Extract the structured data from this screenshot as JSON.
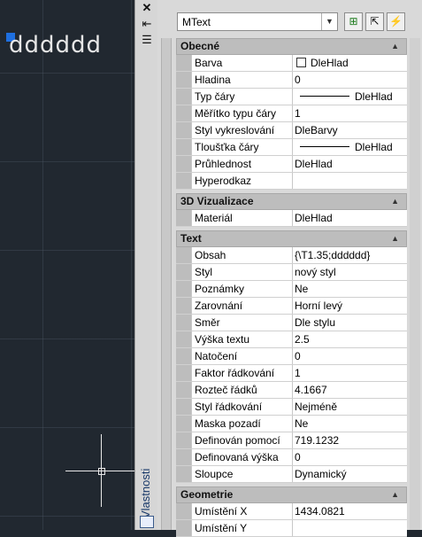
{
  "canvas": {
    "mtext_content": "dddddd"
  },
  "strip": {
    "title": "Vlastnosti",
    "close_glyph": "✕",
    "autohide_glyph": "⇤",
    "menu_glyph": "☰"
  },
  "panel": {
    "object_type": "MText",
    "sections": [
      {
        "title": "Obecné",
        "rows": [
          {
            "name": "Barva",
            "value": "DleHlad",
            "swatch": true
          },
          {
            "name": "Hladina",
            "value": "0"
          },
          {
            "name": "Typ čáry",
            "value": "DleHlad",
            "line": true
          },
          {
            "name": "Měřítko typu čáry",
            "value": "1"
          },
          {
            "name": "Styl vykreslování",
            "value": "DleBarvy"
          },
          {
            "name": "Tloušťka čáry",
            "value": "DleHlad",
            "line": true
          },
          {
            "name": "Průhlednost",
            "value": "DleHlad"
          },
          {
            "name": "Hyperodkaz",
            "value": ""
          }
        ]
      },
      {
        "title": "3D Vizualizace",
        "rows": [
          {
            "name": "Materiál",
            "value": "DleHlad"
          }
        ]
      },
      {
        "title": "Text",
        "rows": [
          {
            "name": "Obsah",
            "value": "{\\T1.35;dddddd}"
          },
          {
            "name": "Styl",
            "value": "nový styl"
          },
          {
            "name": "Poznámky",
            "value": "Ne"
          },
          {
            "name": "Zarovnání",
            "value": "Horní levý"
          },
          {
            "name": "Směr",
            "value": "Dle stylu"
          },
          {
            "name": "Výška textu",
            "value": "2.5"
          },
          {
            "name": "Natočení",
            "value": "0"
          },
          {
            "name": "Faktor řádkování",
            "value": "1"
          },
          {
            "name": "Rozteč řádků",
            "value": "4.1667"
          },
          {
            "name": "Styl řádkování",
            "value": "Nejméně"
          },
          {
            "name": "Maska pozadí",
            "value": "Ne"
          },
          {
            "name": "Definován pomocí",
            "value": "719.1232"
          },
          {
            "name": "Definovaná výška",
            "value": "0"
          },
          {
            "name": "Sloupce",
            "value": "Dynamický"
          }
        ]
      },
      {
        "title": "Geometrie",
        "rows": [
          {
            "name": "Umístění X",
            "value": "1434.0821"
          },
          {
            "name": "Umístění Y",
            "value": ""
          }
        ]
      }
    ]
  }
}
